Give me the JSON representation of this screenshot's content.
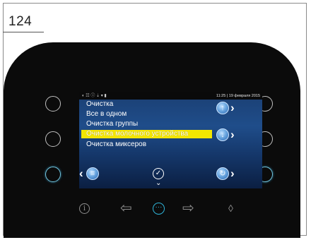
{
  "page": {
    "number": "124"
  },
  "statusbar": {
    "icons": "◐ ☷ ⓘ ⇣ ▾ ▮",
    "datetime": "11:25 | 19 февраля 2015"
  },
  "menu": {
    "items": [
      {
        "label": "Очистка"
      },
      {
        "label": "Все в одном"
      },
      {
        "label": "Очистка группы"
      },
      {
        "label": "Очистка молочного устройства",
        "selected": true
      },
      {
        "label": "Очистка миксеров"
      }
    ]
  },
  "screen_buttons": {
    "up_glyph": "↑",
    "down_glyph": "↓",
    "back_glyph": "≡",
    "refresh_glyph": "↻",
    "confirm_glyph": "✓",
    "confirm_sub_glyph": "⌄",
    "chevron_right": "›",
    "chevron_left": "‹"
  },
  "bottom_bar": {
    "info_glyph": "i",
    "left_glyph": "⇦",
    "menu_glyph": "···",
    "right_glyph": "⇨",
    "drop_glyph": "◊"
  },
  "colors": {
    "selection": "#f3e600",
    "accent": "#74c6e0",
    "screen_bg": "#1f4d8a"
  }
}
